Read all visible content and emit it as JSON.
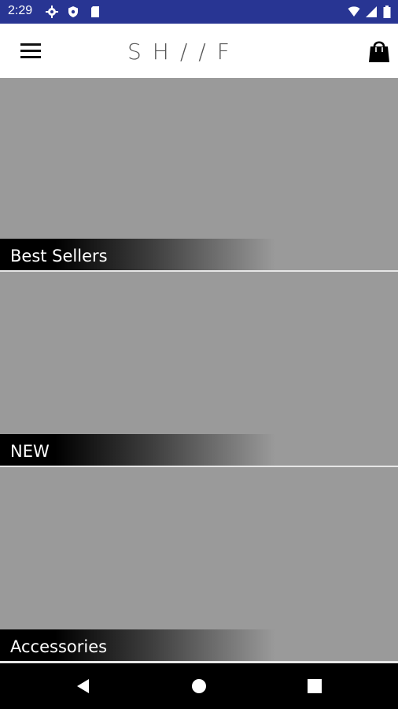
{
  "status_bar": {
    "time": "2:29",
    "icons": [
      "settings-icon",
      "shield-icon",
      "sd-card-icon",
      "wifi-icon",
      "cell-signal-icon",
      "battery-icon"
    ],
    "background_color": "#283593"
  },
  "app_bar": {
    "logo_text": "SH//FT",
    "menu_icon": "hamburger-menu-icon",
    "cart_icon": "shopping-bag-icon"
  },
  "categories": [
    {
      "label": "Best Sellers"
    },
    {
      "label": "NEW"
    },
    {
      "label": "Accessories"
    }
  ],
  "nav_bar": {
    "icons": [
      "back-icon",
      "home-icon",
      "recents-icon"
    ]
  }
}
